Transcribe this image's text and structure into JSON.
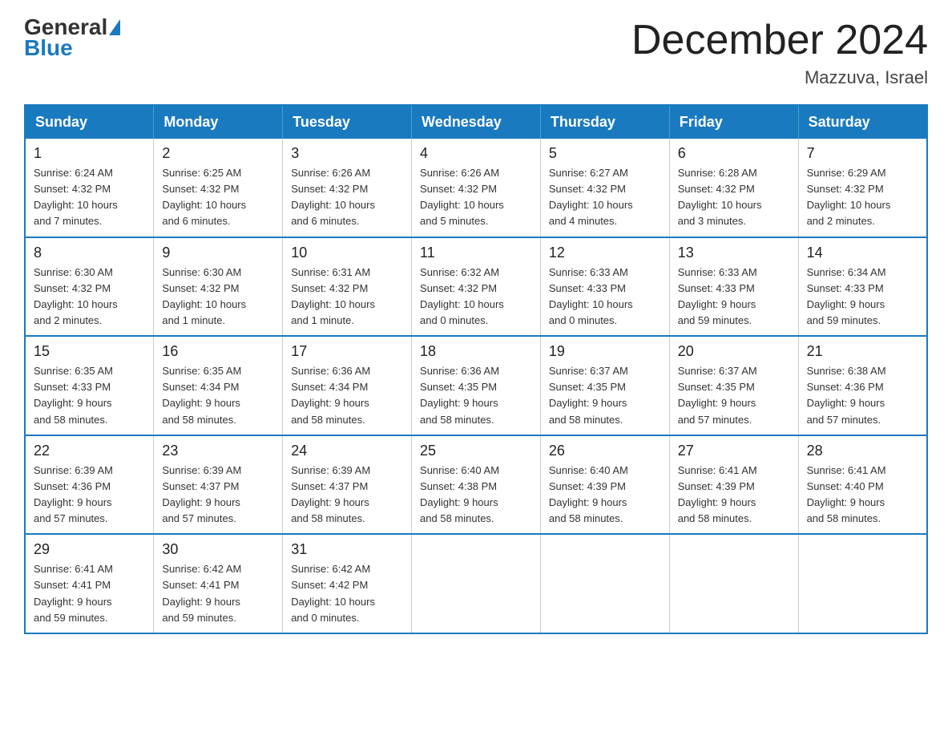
{
  "logo": {
    "general": "General",
    "blue": "Blue"
  },
  "header": {
    "month": "December 2024",
    "location": "Mazzuva, Israel"
  },
  "weekdays": [
    "Sunday",
    "Monday",
    "Tuesday",
    "Wednesday",
    "Thursday",
    "Friday",
    "Saturday"
  ],
  "weeks": [
    [
      {
        "day": "1",
        "info": "Sunrise: 6:24 AM\nSunset: 4:32 PM\nDaylight: 10 hours\nand 7 minutes."
      },
      {
        "day": "2",
        "info": "Sunrise: 6:25 AM\nSunset: 4:32 PM\nDaylight: 10 hours\nand 6 minutes."
      },
      {
        "day": "3",
        "info": "Sunrise: 6:26 AM\nSunset: 4:32 PM\nDaylight: 10 hours\nand 6 minutes."
      },
      {
        "day": "4",
        "info": "Sunrise: 6:26 AM\nSunset: 4:32 PM\nDaylight: 10 hours\nand 5 minutes."
      },
      {
        "day": "5",
        "info": "Sunrise: 6:27 AM\nSunset: 4:32 PM\nDaylight: 10 hours\nand 4 minutes."
      },
      {
        "day": "6",
        "info": "Sunrise: 6:28 AM\nSunset: 4:32 PM\nDaylight: 10 hours\nand 3 minutes."
      },
      {
        "day": "7",
        "info": "Sunrise: 6:29 AM\nSunset: 4:32 PM\nDaylight: 10 hours\nand 2 minutes."
      }
    ],
    [
      {
        "day": "8",
        "info": "Sunrise: 6:30 AM\nSunset: 4:32 PM\nDaylight: 10 hours\nand 2 minutes."
      },
      {
        "day": "9",
        "info": "Sunrise: 6:30 AM\nSunset: 4:32 PM\nDaylight: 10 hours\nand 1 minute."
      },
      {
        "day": "10",
        "info": "Sunrise: 6:31 AM\nSunset: 4:32 PM\nDaylight: 10 hours\nand 1 minute."
      },
      {
        "day": "11",
        "info": "Sunrise: 6:32 AM\nSunset: 4:32 PM\nDaylight: 10 hours\nand 0 minutes."
      },
      {
        "day": "12",
        "info": "Sunrise: 6:33 AM\nSunset: 4:33 PM\nDaylight: 10 hours\nand 0 minutes."
      },
      {
        "day": "13",
        "info": "Sunrise: 6:33 AM\nSunset: 4:33 PM\nDaylight: 9 hours\nand 59 minutes."
      },
      {
        "day": "14",
        "info": "Sunrise: 6:34 AM\nSunset: 4:33 PM\nDaylight: 9 hours\nand 59 minutes."
      }
    ],
    [
      {
        "day": "15",
        "info": "Sunrise: 6:35 AM\nSunset: 4:33 PM\nDaylight: 9 hours\nand 58 minutes."
      },
      {
        "day": "16",
        "info": "Sunrise: 6:35 AM\nSunset: 4:34 PM\nDaylight: 9 hours\nand 58 minutes."
      },
      {
        "day": "17",
        "info": "Sunrise: 6:36 AM\nSunset: 4:34 PM\nDaylight: 9 hours\nand 58 minutes."
      },
      {
        "day": "18",
        "info": "Sunrise: 6:36 AM\nSunset: 4:35 PM\nDaylight: 9 hours\nand 58 minutes."
      },
      {
        "day": "19",
        "info": "Sunrise: 6:37 AM\nSunset: 4:35 PM\nDaylight: 9 hours\nand 58 minutes."
      },
      {
        "day": "20",
        "info": "Sunrise: 6:37 AM\nSunset: 4:35 PM\nDaylight: 9 hours\nand 57 minutes."
      },
      {
        "day": "21",
        "info": "Sunrise: 6:38 AM\nSunset: 4:36 PM\nDaylight: 9 hours\nand 57 minutes."
      }
    ],
    [
      {
        "day": "22",
        "info": "Sunrise: 6:39 AM\nSunset: 4:36 PM\nDaylight: 9 hours\nand 57 minutes."
      },
      {
        "day": "23",
        "info": "Sunrise: 6:39 AM\nSunset: 4:37 PM\nDaylight: 9 hours\nand 57 minutes."
      },
      {
        "day": "24",
        "info": "Sunrise: 6:39 AM\nSunset: 4:37 PM\nDaylight: 9 hours\nand 58 minutes."
      },
      {
        "day": "25",
        "info": "Sunrise: 6:40 AM\nSunset: 4:38 PM\nDaylight: 9 hours\nand 58 minutes."
      },
      {
        "day": "26",
        "info": "Sunrise: 6:40 AM\nSunset: 4:39 PM\nDaylight: 9 hours\nand 58 minutes."
      },
      {
        "day": "27",
        "info": "Sunrise: 6:41 AM\nSunset: 4:39 PM\nDaylight: 9 hours\nand 58 minutes."
      },
      {
        "day": "28",
        "info": "Sunrise: 6:41 AM\nSunset: 4:40 PM\nDaylight: 9 hours\nand 58 minutes."
      }
    ],
    [
      {
        "day": "29",
        "info": "Sunrise: 6:41 AM\nSunset: 4:41 PM\nDaylight: 9 hours\nand 59 minutes."
      },
      {
        "day": "30",
        "info": "Sunrise: 6:42 AM\nSunset: 4:41 PM\nDaylight: 9 hours\nand 59 minutes."
      },
      {
        "day": "31",
        "info": "Sunrise: 6:42 AM\nSunset: 4:42 PM\nDaylight: 10 hours\nand 0 minutes."
      },
      {
        "day": "",
        "info": ""
      },
      {
        "day": "",
        "info": ""
      },
      {
        "day": "",
        "info": ""
      },
      {
        "day": "",
        "info": ""
      }
    ]
  ]
}
